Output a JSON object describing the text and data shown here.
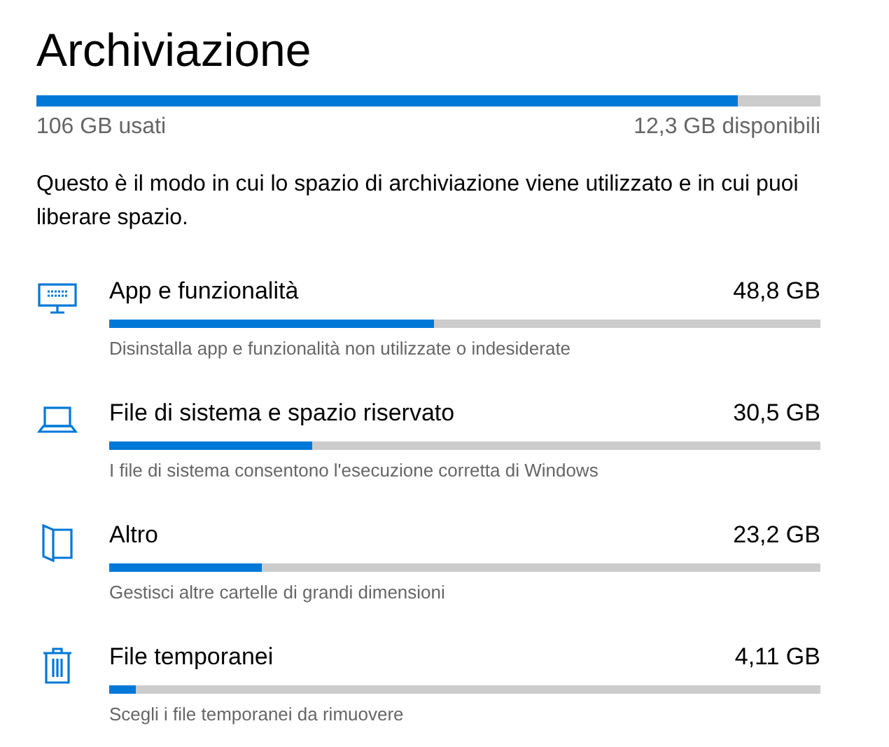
{
  "title": "Archiviazione",
  "usage": {
    "level": 0.895,
    "used": "106 GB usati",
    "free": "12,3 GB disponibili"
  },
  "description": "Questo è il modo in cui lo spazio di archiviazione viene utilizzato e in cui puoi liberare spazio.",
  "categories": [
    {
      "kind": "apps",
      "name": "App e funzionalità",
      "size": "48,8 GB",
      "level": 0.456,
      "hint": "Disinstalla app e funzionalità non utilizzate o indesiderate"
    },
    {
      "kind": "system",
      "name": "File di sistema e spazio riservato",
      "size": "30,5 GB",
      "level": 0.285,
      "hint": "I file di sistema consentono l'esecuzione corretta di Windows"
    },
    {
      "kind": "other",
      "name": "Altro",
      "size": "23,2 GB",
      "level": 0.215,
      "hint": "Gestisci altre cartelle di grandi dimensioni"
    },
    {
      "kind": "temp",
      "name": "File temporanei",
      "size": "4,11 GB",
      "level": 0.038,
      "hint": "Scegli i file temporanei da rimuovere"
    }
  ]
}
